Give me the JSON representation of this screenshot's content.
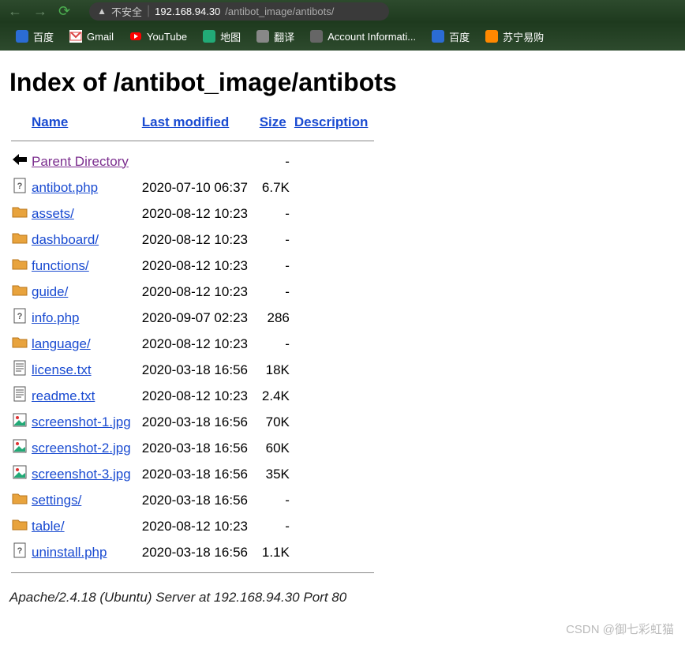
{
  "browser": {
    "warn_label": "不安全",
    "url_host": "192.168.94.30",
    "url_path": "/antibot_image/antibots/"
  },
  "bookmarks": [
    {
      "label": "百度",
      "icon": "baidu"
    },
    {
      "label": "Gmail",
      "icon": "gmail"
    },
    {
      "label": "YouTube",
      "icon": "youtube"
    },
    {
      "label": "地图",
      "icon": "maps"
    },
    {
      "label": "翻译",
      "icon": "translate"
    },
    {
      "label": "Account Informati...",
      "icon": "account"
    },
    {
      "label": "百度",
      "icon": "baidu"
    },
    {
      "label": "苏宁易购",
      "icon": "suning"
    }
  ],
  "page": {
    "heading": "Index of /antibot_image/antibots",
    "columns": {
      "name": "Name",
      "modified": "Last modified",
      "size": "Size",
      "desc": "Description"
    },
    "parent_label": "Parent Directory",
    "entries": [
      {
        "name": "antibot.php",
        "modified": "2020-07-10 06:37",
        "size": "6.7K",
        "type": "php"
      },
      {
        "name": "assets/",
        "modified": "2020-08-12 10:23",
        "size": "-",
        "type": "dir"
      },
      {
        "name": "dashboard/",
        "modified": "2020-08-12 10:23",
        "size": "-",
        "type": "dir"
      },
      {
        "name": "functions/",
        "modified": "2020-08-12 10:23",
        "size": "-",
        "type": "dir"
      },
      {
        "name": "guide/",
        "modified": "2020-08-12 10:23",
        "size": "-",
        "type": "dir"
      },
      {
        "name": "info.php",
        "modified": "2020-09-07 02:23",
        "size": "286",
        "type": "php"
      },
      {
        "name": "language/",
        "modified": "2020-08-12 10:23",
        "size": "-",
        "type": "dir"
      },
      {
        "name": "license.txt",
        "modified": "2020-03-18 16:56",
        "size": "18K",
        "type": "txt"
      },
      {
        "name": "readme.txt",
        "modified": "2020-08-12 10:23",
        "size": "2.4K",
        "type": "txt"
      },
      {
        "name": "screenshot-1.jpg",
        "modified": "2020-03-18 16:56",
        "size": "70K",
        "type": "img"
      },
      {
        "name": "screenshot-2.jpg",
        "modified": "2020-03-18 16:56",
        "size": "60K",
        "type": "img"
      },
      {
        "name": "screenshot-3.jpg",
        "modified": "2020-03-18 16:56",
        "size": "35K",
        "type": "img"
      },
      {
        "name": "settings/",
        "modified": "2020-03-18 16:56",
        "size": "-",
        "type": "dir"
      },
      {
        "name": "table/",
        "modified": "2020-08-12 10:23",
        "size": "-",
        "type": "dir"
      },
      {
        "name": "uninstall.php",
        "modified": "2020-03-18 16:56",
        "size": "1.1K",
        "type": "php"
      }
    ],
    "server_line": "Apache/2.4.18 (Ubuntu) Server at 192.168.94.30 Port 80"
  },
  "watermark": "CSDN @御七彩虹猫"
}
